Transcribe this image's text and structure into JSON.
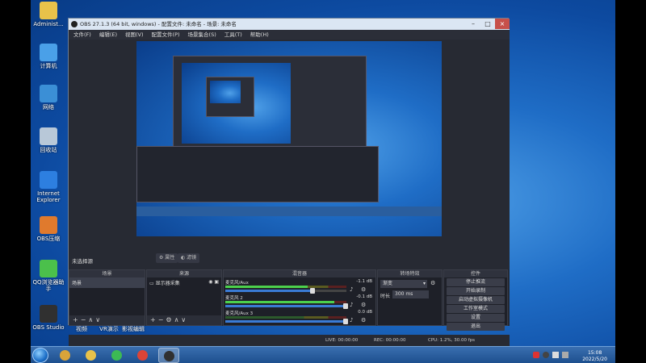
{
  "desktop": {
    "icons": [
      {
        "label": "Administ...",
        "color": "#e8c24a"
      },
      {
        "label": "计算机",
        "color": "#4aa0e8"
      },
      {
        "label": "网络",
        "color": "#3b8fd6"
      },
      {
        "label": "回收站",
        "color": "#b8c8d8"
      },
      {
        "label": "Internet Explorer",
        "color": "#2d7fe0"
      },
      {
        "label": "OBS压缩",
        "color": "#e07a2d"
      },
      {
        "label": "QQ浏览器助手",
        "color": "#4bc04b"
      },
      {
        "label": "OBS Studio",
        "color": "#303030"
      }
    ],
    "bottom_labels": [
      "视频",
      "VR演示",
      "影视编辑"
    ]
  },
  "obs": {
    "title": "OBS 27.1.3 (64 bit, windows) - 配置文件: 未命名 - 场景: 未命名",
    "menu": [
      "文件(F)",
      "编辑(E)",
      "视图(V)",
      "配置文件(P)",
      "场景集合(S)",
      "工具(T)",
      "帮助(H)"
    ],
    "scene_bar_label": "未选择源",
    "props_button": "属性",
    "filters_button": "滤镜",
    "docks": {
      "scenes": {
        "title": "场景",
        "items": [
          "场景"
        ]
      },
      "sources": {
        "title": "来源",
        "items": [
          "显示器采集"
        ]
      },
      "mixer": {
        "title": "混音器",
        "channels": [
          {
            "name": "麦克风/Aux",
            "db": "-1.1 dB",
            "level": 0.68,
            "volume": 0.72
          },
          {
            "name": "麦克风 2",
            "db": "-0.1 dB",
            "level": 0.9,
            "volume": 0.99
          },
          {
            "name": "麦克风/Aux 3",
            "db": "0.0 dB",
            "level": 0.0,
            "volume": 0.99
          }
        ]
      },
      "transitions": {
        "title": "转场特效",
        "type": "渐变",
        "duration_label": "时长",
        "duration": "300 ms"
      },
      "controls": {
        "title": "控件",
        "buttons": [
          "停止推流",
          "开始录制",
          "启动虚拟摄像机",
          "工作室模式",
          "设置",
          "退出"
        ]
      }
    },
    "status": {
      "live": "LIVE: 00:00:00",
      "rec": "REC: 00:00:00",
      "cpu": "CPU: 1.2%, 30.00 fps"
    }
  },
  "taskbar": {
    "apps": [
      {
        "name": "explorer",
        "color": "#d9a43a"
      },
      {
        "name": "G",
        "color": "#e8c24a"
      },
      {
        "name": "media",
        "color": "#3cba54"
      },
      {
        "name": "chrome",
        "color": "#db4437"
      },
      {
        "name": "obs",
        "color": "#303030"
      }
    ],
    "clock_time": "15:08",
    "clock_date": "2022/5/20",
    "colors": {
      "taskbar": "#2a5e9e",
      "accent": "#3a7bd5"
    }
  }
}
